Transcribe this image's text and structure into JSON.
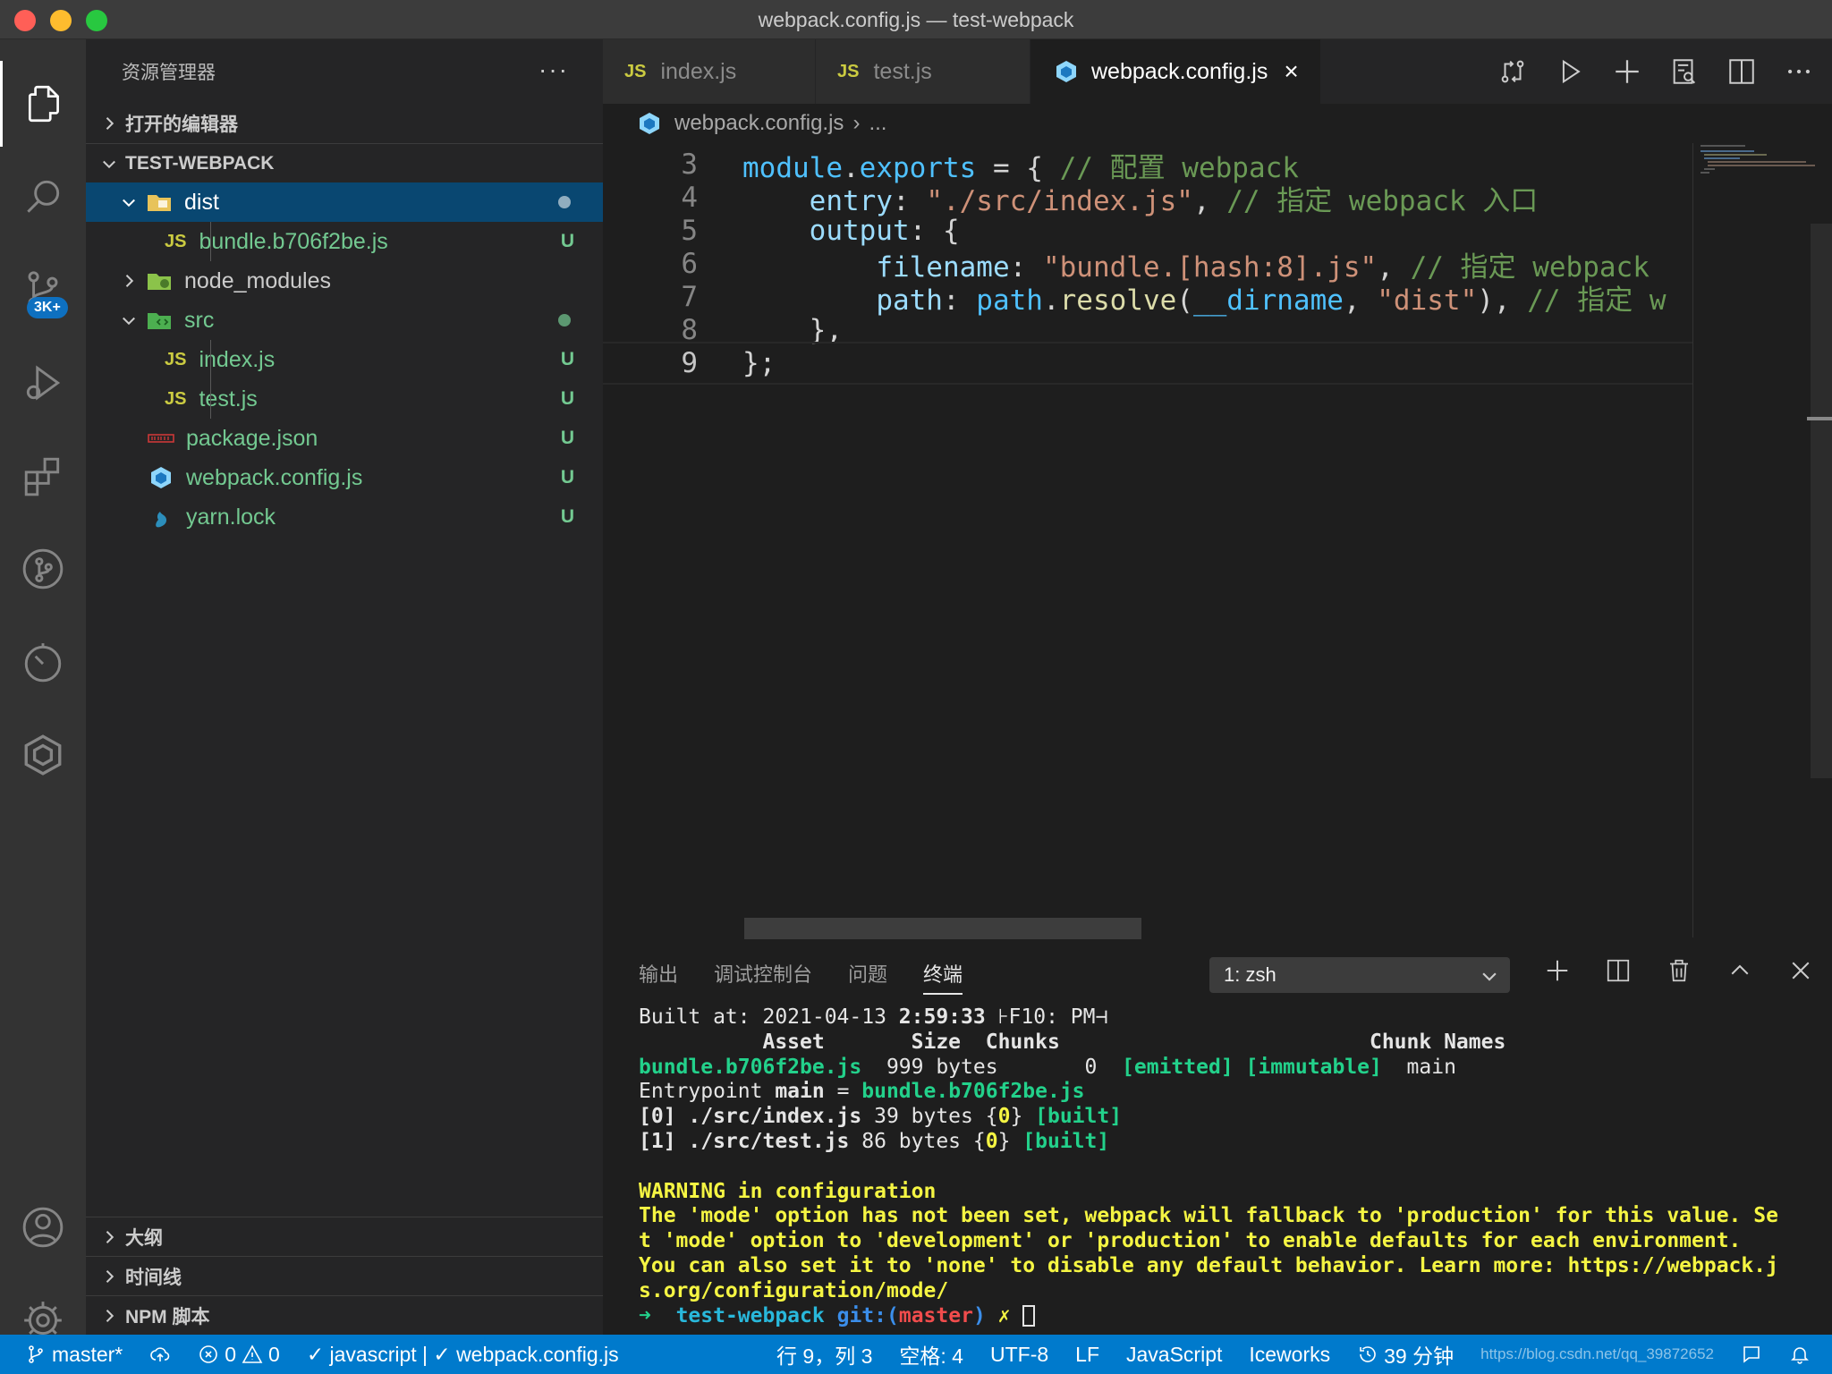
{
  "window": {
    "title": "webpack.config.js — test-webpack"
  },
  "activity_bar": {
    "scm_badge": "3K+"
  },
  "sidebar": {
    "header": "资源管理器",
    "more": "···",
    "open_editors": "打开的编辑器",
    "project": "TEST-WEBPACK",
    "tree": [
      {
        "name": "dist",
        "status": ""
      },
      {
        "name": "bundle.b706f2be.js",
        "status": "U"
      },
      {
        "name": "node_modules",
        "status": ""
      },
      {
        "name": "src",
        "status": ""
      },
      {
        "name": "index.js",
        "status": "U"
      },
      {
        "name": "test.js",
        "status": "U"
      },
      {
        "name": "package.json",
        "status": "U"
      },
      {
        "name": "webpack.config.js",
        "status": "U"
      },
      {
        "name": "yarn.lock",
        "status": "U"
      }
    ],
    "js_badge": "JS",
    "bottom_sections": [
      "大纲",
      "时间线",
      "NPM 脚本"
    ]
  },
  "editor": {
    "tabs": [
      {
        "label": "index.js",
        "active": false
      },
      {
        "label": "test.js",
        "active": false
      },
      {
        "label": "webpack.config.js",
        "active": true
      }
    ],
    "tab_close": "×",
    "breadcrumb": {
      "file": "webpack.config.js",
      "sep": "›",
      "rest": "..."
    },
    "line_numbers": [
      "3",
      "4",
      "5",
      "6",
      "7",
      "8",
      "9"
    ],
    "code": {
      "l3": [
        "module",
        ".",
        "exports",
        " = { ",
        "// 配置 webpack"
      ],
      "l4": [
        "    ",
        "entry",
        ": ",
        "\"./src/index.js\"",
        ", ",
        "// 指定 webpack 入口"
      ],
      "l5": [
        "    ",
        "output",
        ": {"
      ],
      "l6": [
        "        ",
        "filename",
        ": ",
        "\"bundle.[hash:8].js\"",
        ", ",
        "// 指定 webpack"
      ],
      "l7": [
        "        ",
        "path",
        ": ",
        "path",
        ".",
        "resolve",
        "(",
        "__dirname",
        ", ",
        "\"dist\"",
        "), ",
        "// 指定 w"
      ],
      "l8": [
        "    },"
      ],
      "l9": [
        "};"
      ]
    }
  },
  "panel": {
    "tabs": [
      "输出",
      "调试控制台",
      "问题",
      "终端"
    ],
    "active_tab": "终端",
    "terminal_select": "1: zsh",
    "terminal": {
      "built_prefix": "Built at: 2021-04-13 ",
      "built_time": "2:59:33",
      "built_suffix": " ⊦F10: PM⊣",
      "header_asset": "          Asset       Size  Chunks                         Chunk Names",
      "asset_name": "bundle.b706f2be.js",
      "asset_rest": "  999 bytes       0  ",
      "asset_flags": "[emitted] [immutable]",
      "asset_chunk": "  main",
      "entry_prefix": "Entrypoint ",
      "entry_main": "main",
      "entry_eq": " = ",
      "entry_file": "bundle.b706f2be.js",
      "mod0_prefix": "[0] ./src/index.js",
      "mod0_size": " 39 bytes {",
      "mod0_id": "0",
      "mod0_close": "} ",
      "mod0_built": "[built]",
      "mod1_prefix": "[1] ./src/test.js",
      "mod1_size": " 86 bytes {",
      "mod1_id": "0",
      "mod1_close": "} ",
      "mod1_built": "[built]",
      "warn_title": "WARNING in configuration",
      "warn_1": "The 'mode' option has not been set, webpack will fallback to 'production' for this value. Se",
      "warn_2": "t 'mode' option to 'development' or 'production' to enable defaults for each environment.",
      "warn_3": "You can also set it to 'none' to disable any default behavior. Learn more: https://webpack.j",
      "warn_4": "s.org/configuration/mode/",
      "prompt_arrow": "➜",
      "prompt_dir": "test-webpack",
      "prompt_git": "git:(",
      "prompt_branch": "master",
      "prompt_git_close": ")",
      "prompt_x": "✗"
    }
  },
  "status_bar": {
    "branch": "master*",
    "errors": "0",
    "warnings": "0",
    "lint": "✓ javascript | ✓ webpack.config.js",
    "position": "行 9，列 3",
    "spaces": "空格: 4",
    "encoding": "UTF-8",
    "eol": "LF",
    "language": "JavaScript",
    "extension": "Iceworks",
    "time": "39 分钟",
    "watermark": "https://blog.csdn.net/qq_39872652"
  },
  "colors": {
    "accent": "#007acc",
    "selection": "#094771",
    "git_untracked": "#73c991"
  }
}
